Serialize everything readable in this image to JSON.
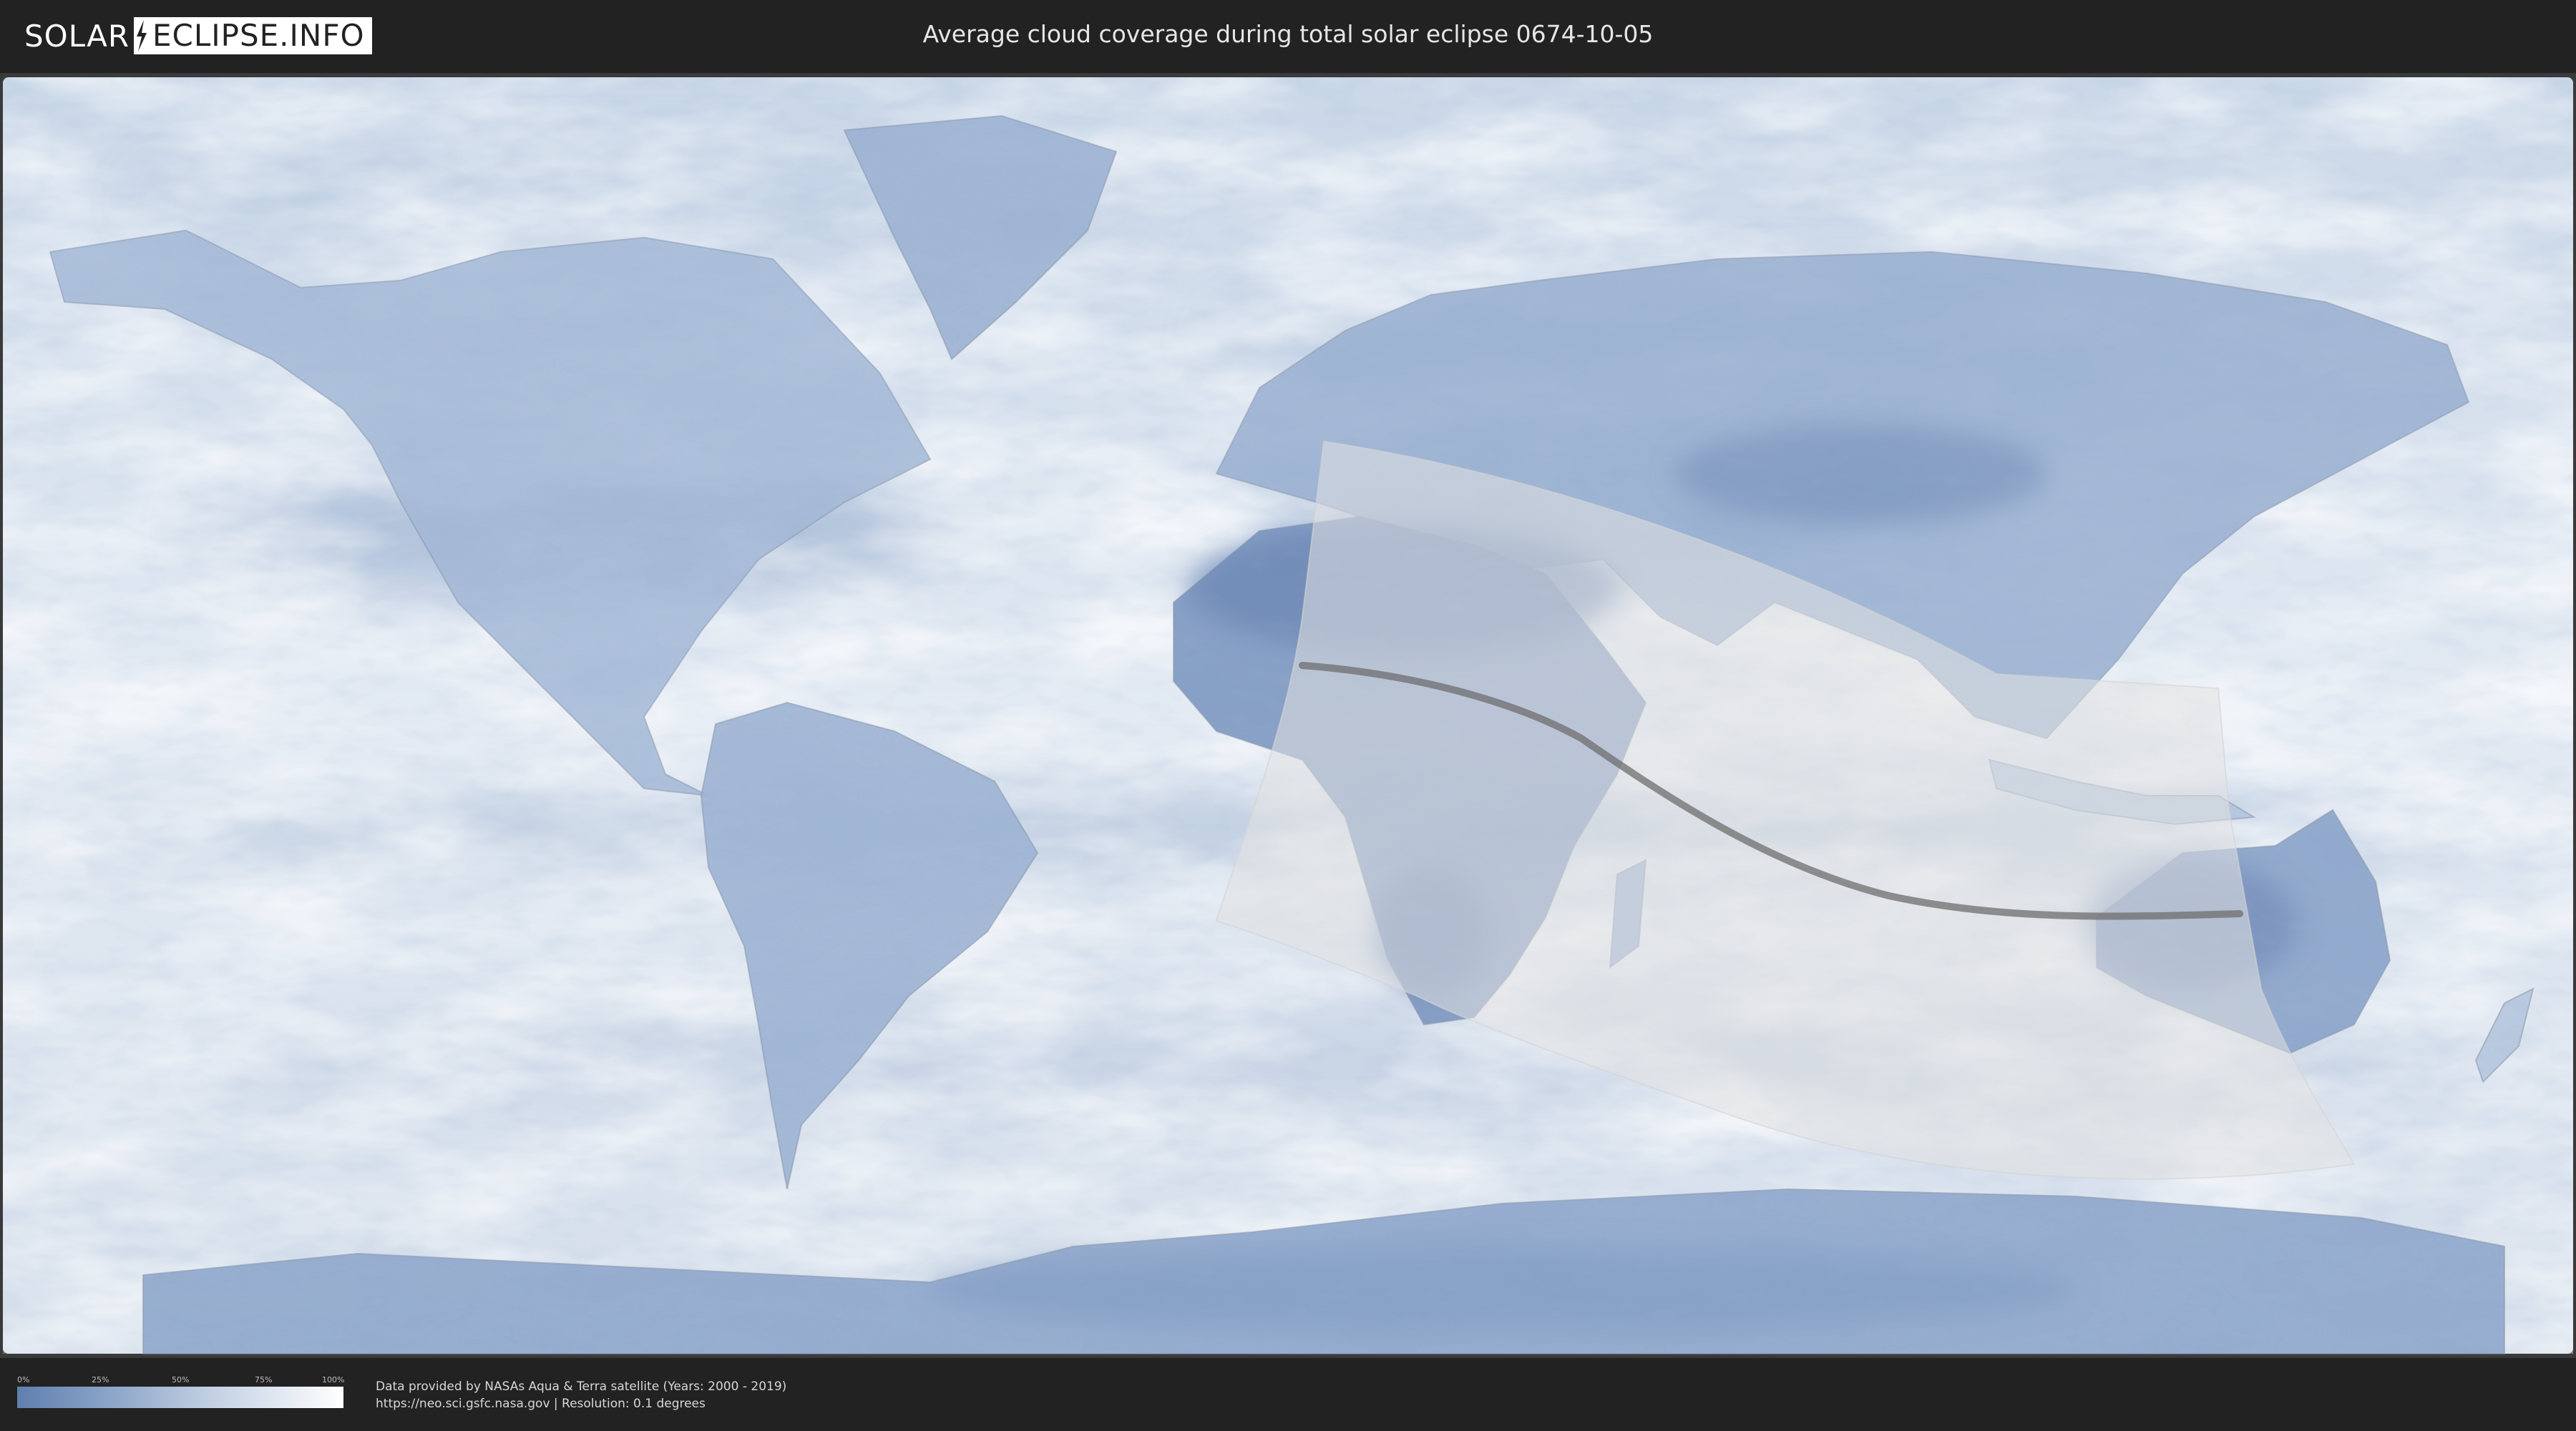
{
  "header": {
    "logo_left": "SOLAR",
    "logo_right": "ECLIPSE.INFO",
    "title": "Average cloud coverage during total solar eclipse 0674-10-05"
  },
  "map": {
    "icons": {
      "cloud_layer": "cloud-coverage-layer-icon",
      "continents": "continent-outline-icon",
      "penumbra": "penumbra-zone-icon",
      "path": "totality-path-icon"
    },
    "colors": {
      "clear_sky": "#5f7fae",
      "cloud": "#ffffff",
      "penumbra_fill": "#e2e2e2",
      "path_line": "#6e6e6e"
    }
  },
  "legend": {
    "ticks": [
      "0%",
      "25%",
      "50%",
      "75%",
      "100%"
    ],
    "gradient_from": "#5f7fae",
    "gradient_to": "#ffffff"
  },
  "credits": {
    "line1": "Data provided by NASAs Aqua & Terra satellite (Years: 2000 - 2019)",
    "line2": "https://neo.sci.gsfc.nasa.gov | Resolution: 0.1 degrees"
  }
}
